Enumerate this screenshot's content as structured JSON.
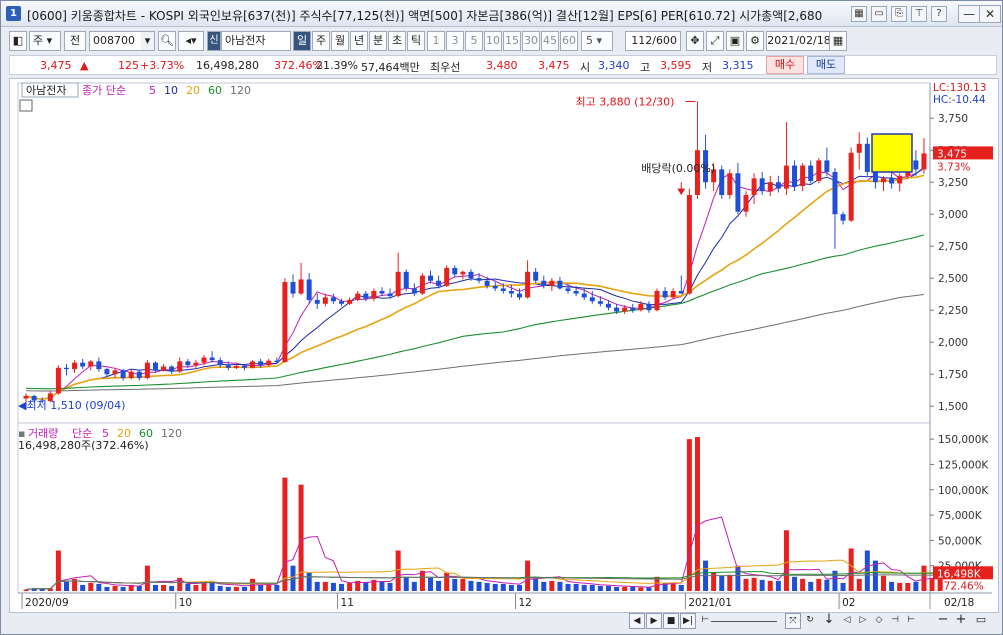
{
  "titlebar": {
    "title": "[0600] 키움종합차트 - KOSPI 외국인보유[637(천)] 주식수[77,125(천)] 액면[500] 자본금[386(억)] 결산[12월] EPS[6] PER[610.72] 시가총액[2,680",
    "app_icon": "1"
  },
  "toolbar": {
    "period_type": "주",
    "prev_label": "전",
    "code": "008700",
    "market_tag": "신",
    "stock_name": "아남전자",
    "periods": [
      "일",
      "주",
      "월",
      "년",
      "분",
      "초",
      "틱"
    ],
    "active_period": "일",
    "intervals": [
      "1",
      "3",
      "5",
      "10",
      "15",
      "30",
      "45",
      "60"
    ],
    "custom_interval": "5",
    "count": "112/600",
    "date": "2021/02/18"
  },
  "quote": {
    "price": "3,475",
    "change": "125",
    "change_pct": "+3.73%",
    "volume": "16,498,280",
    "volume_ratio": "372.46%",
    "turnover": "21.39%",
    "amount": "57,464백만",
    "best_label": "최우선",
    "ask": "3,480",
    "bid": "3,475",
    "open_label": "시",
    "open": "3,340",
    "high_label": "고",
    "high": "3,595",
    "low_label": "저",
    "low": "3,315",
    "buy_label": "매수",
    "sell_label": "매도"
  },
  "chart_data": {
    "type": "candlestick",
    "price_legend": {
      "name": "아남전자",
      "ma_title": "종가 단순",
      "ma_periods": [
        "5",
        "10",
        "20",
        "60",
        "120"
      ],
      "ma_colors": [
        "#c21fb4",
        "#1a2aa8",
        "#e6a410",
        "#1b8f2e",
        "#6e6e6e"
      ]
    },
    "price_axis": {
      "ticks": [
        "3,750",
        "3,500",
        "3,250",
        "3,000",
        "2,750",
        "2,500",
        "2,250",
        "2,000",
        "1,750",
        "1,500"
      ],
      "range": [
        1400,
        3900
      ],
      "lc": "LC:130.13",
      "hc": "HC:-10.44",
      "current": "3,475",
      "current_pct": "3.73%"
    },
    "annotations": {
      "high": "최고 3,880 (12/30)",
      "low": "최저 1,510 (09/04)",
      "dividend": "배당락(0.00%)"
    },
    "volume_legend": {
      "name": "거래량",
      "ma_title": "단순",
      "ma_periods": [
        "5",
        "20",
        "60",
        "120"
      ],
      "ma_colors": [
        "#c21fb4",
        "#e6a410",
        "#1b8f2e",
        "#6e6e6e"
      ],
      "current": "16,498,280주(372.46%)"
    },
    "volume_axis": {
      "ticks": [
        "150,000K",
        "125,000K",
        "100,000K",
        "75,000K",
        "50,000K",
        "25,000K"
      ],
      "range": [
        0,
        160000
      ],
      "current": "16,498K",
      "current_pct": "372.46%"
    },
    "x_axis": {
      "labels": [
        "2020/09",
        "10",
        "11",
        "12",
        "2021/01",
        "02"
      ],
      "last_date": "02/18"
    },
    "candles": [
      {
        "o": 1560,
        "h": 1600,
        "l": 1510,
        "c": 1580
      },
      {
        "o": 1580,
        "h": 1590,
        "l": 1530,
        "c": 1545
      },
      {
        "o": 1545,
        "h": 1570,
        "l": 1525,
        "c": 1540
      },
      {
        "o": 1540,
        "h": 1620,
        "l": 1530,
        "c": 1600
      },
      {
        "o": 1600,
        "h": 1820,
        "l": 1590,
        "c": 1800
      },
      {
        "o": 1800,
        "h": 1830,
        "l": 1740,
        "c": 1790
      },
      {
        "o": 1790,
        "h": 1860,
        "l": 1760,
        "c": 1840
      },
      {
        "o": 1840,
        "h": 1870,
        "l": 1790,
        "c": 1810
      },
      {
        "o": 1810,
        "h": 1860,
        "l": 1780,
        "c": 1850
      },
      {
        "o": 1850,
        "h": 1880,
        "l": 1770,
        "c": 1790
      },
      {
        "o": 1790,
        "h": 1800,
        "l": 1730,
        "c": 1750
      },
      {
        "o": 1750,
        "h": 1800,
        "l": 1720,
        "c": 1780
      },
      {
        "o": 1780,
        "h": 1790,
        "l": 1700,
        "c": 1720
      },
      {
        "o": 1720,
        "h": 1790,
        "l": 1710,
        "c": 1770
      },
      {
        "o": 1770,
        "h": 1780,
        "l": 1700,
        "c": 1720
      },
      {
        "o": 1720,
        "h": 1860,
        "l": 1710,
        "c": 1840
      },
      {
        "o": 1840,
        "h": 1850,
        "l": 1760,
        "c": 1780
      },
      {
        "o": 1780,
        "h": 1830,
        "l": 1770,
        "c": 1810
      },
      {
        "o": 1810,
        "h": 1820,
        "l": 1750,
        "c": 1770
      },
      {
        "o": 1770,
        "h": 1880,
        "l": 1760,
        "c": 1850
      },
      {
        "o": 1850,
        "h": 1870,
        "l": 1800,
        "c": 1820
      },
      {
        "o": 1820,
        "h": 1860,
        "l": 1790,
        "c": 1840
      },
      {
        "o": 1840,
        "h": 1900,
        "l": 1820,
        "c": 1880
      },
      {
        "o": 1880,
        "h": 1930,
        "l": 1840,
        "c": 1860
      },
      {
        "o": 1860,
        "h": 1880,
        "l": 1800,
        "c": 1820
      },
      {
        "o": 1820,
        "h": 1850,
        "l": 1780,
        "c": 1800
      },
      {
        "o": 1800,
        "h": 1830,
        "l": 1790,
        "c": 1815
      },
      {
        "o": 1815,
        "h": 1830,
        "l": 1780,
        "c": 1800
      },
      {
        "o": 1800,
        "h": 1860,
        "l": 1795,
        "c": 1850
      },
      {
        "o": 1850,
        "h": 1870,
        "l": 1800,
        "c": 1820
      },
      {
        "o": 1820,
        "h": 1870,
        "l": 1810,
        "c": 1855
      },
      {
        "o": 1855,
        "h": 1880,
        "l": 1830,
        "c": 1845
      },
      {
        "o": 1845,
        "h": 2500,
        "l": 1840,
        "c": 2470
      },
      {
        "o": 2470,
        "h": 2530,
        "l": 2350,
        "c": 2380
      },
      {
        "o": 2380,
        "h": 2620,
        "l": 2370,
        "c": 2490
      },
      {
        "o": 2490,
        "h": 2540,
        "l": 2300,
        "c": 2330
      },
      {
        "o": 2330,
        "h": 2380,
        "l": 2260,
        "c": 2300
      },
      {
        "o": 2300,
        "h": 2380,
        "l": 2280,
        "c": 2350
      },
      {
        "o": 2350,
        "h": 2380,
        "l": 2300,
        "c": 2320
      },
      {
        "o": 2320,
        "h": 2340,
        "l": 2280,
        "c": 2300
      },
      {
        "o": 2300,
        "h": 2350,
        "l": 2290,
        "c": 2330
      },
      {
        "o": 2330,
        "h": 2400,
        "l": 2320,
        "c": 2380
      },
      {
        "o": 2380,
        "h": 2400,
        "l": 2320,
        "c": 2340
      },
      {
        "o": 2340,
        "h": 2420,
        "l": 2320,
        "c": 2400
      },
      {
        "o": 2400,
        "h": 2430,
        "l": 2360,
        "c": 2380
      },
      {
        "o": 2380,
        "h": 2420,
        "l": 2340,
        "c": 2360
      },
      {
        "o": 2360,
        "h": 2700,
        "l": 2350,
        "c": 2550
      },
      {
        "o": 2550,
        "h": 2570,
        "l": 2400,
        "c": 2420
      },
      {
        "o": 2420,
        "h": 2460,
        "l": 2360,
        "c": 2380
      },
      {
        "o": 2380,
        "h": 2540,
        "l": 2370,
        "c": 2520
      },
      {
        "o": 2520,
        "h": 2560,
        "l": 2460,
        "c": 2480
      },
      {
        "o": 2480,
        "h": 2520,
        "l": 2420,
        "c": 2440
      },
      {
        "o": 2440,
        "h": 2600,
        "l": 2430,
        "c": 2580
      },
      {
        "o": 2580,
        "h": 2600,
        "l": 2510,
        "c": 2530
      },
      {
        "o": 2530,
        "h": 2560,
        "l": 2490,
        "c": 2550
      },
      {
        "o": 2550,
        "h": 2570,
        "l": 2480,
        "c": 2500
      },
      {
        "o": 2500,
        "h": 2540,
        "l": 2460,
        "c": 2480
      },
      {
        "o": 2480,
        "h": 2510,
        "l": 2420,
        "c": 2440
      },
      {
        "o": 2440,
        "h": 2480,
        "l": 2400,
        "c": 2420
      },
      {
        "o": 2420,
        "h": 2460,
        "l": 2380,
        "c": 2400
      },
      {
        "o": 2400,
        "h": 2450,
        "l": 2350,
        "c": 2380
      },
      {
        "o": 2380,
        "h": 2420,
        "l": 2330,
        "c": 2350
      },
      {
        "o": 2350,
        "h": 2640,
        "l": 2340,
        "c": 2550
      },
      {
        "o": 2550,
        "h": 2580,
        "l": 2460,
        "c": 2480
      },
      {
        "o": 2480,
        "h": 2520,
        "l": 2420,
        "c": 2440
      },
      {
        "o": 2440,
        "h": 2500,
        "l": 2400,
        "c": 2480
      },
      {
        "o": 2480,
        "h": 2510,
        "l": 2410,
        "c": 2420
      },
      {
        "o": 2420,
        "h": 2460,
        "l": 2380,
        "c": 2400
      },
      {
        "o": 2400,
        "h": 2440,
        "l": 2360,
        "c": 2380
      },
      {
        "o": 2380,
        "h": 2420,
        "l": 2330,
        "c": 2350
      },
      {
        "o": 2350,
        "h": 2400,
        "l": 2300,
        "c": 2320
      },
      {
        "o": 2320,
        "h": 2360,
        "l": 2280,
        "c": 2300
      },
      {
        "o": 2300,
        "h": 2330,
        "l": 2250,
        "c": 2270
      },
      {
        "o": 2270,
        "h": 2300,
        "l": 2220,
        "c": 2240
      },
      {
        "o": 2240,
        "h": 2290,
        "l": 2220,
        "c": 2270
      },
      {
        "o": 2270,
        "h": 2300,
        "l": 2230,
        "c": 2250
      },
      {
        "o": 2250,
        "h": 2320,
        "l": 2240,
        "c": 2300
      },
      {
        "o": 2300,
        "h": 2320,
        "l": 2230,
        "c": 2250
      },
      {
        "o": 2250,
        "h": 2420,
        "l": 2240,
        "c": 2400
      },
      {
        "o": 2400,
        "h": 2430,
        "l": 2330,
        "c": 2350
      },
      {
        "o": 2350,
        "h": 2420,
        "l": 2340,
        "c": 2400
      },
      {
        "o": 2400,
        "h": 2520,
        "l": 2390,
        "c": 2380
      },
      {
        "o": 2380,
        "h": 3200,
        "l": 2370,
        "c": 3150
      },
      {
        "o": 3150,
        "h": 3880,
        "l": 3120,
        "c": 3500
      },
      {
        "o": 3500,
        "h": 3620,
        "l": 3200,
        "c": 3250
      },
      {
        "o": 3250,
        "h": 3400,
        "l": 3180,
        "c": 3350
      },
      {
        "o": 3350,
        "h": 3380,
        "l": 3120,
        "c": 3150
      },
      {
        "o": 3150,
        "h": 3350,
        "l": 3120,
        "c": 3320
      },
      {
        "o": 3320,
        "h": 3400,
        "l": 3000,
        "c": 3020
      },
      {
        "o": 3020,
        "h": 3180,
        "l": 2980,
        "c": 3150
      },
      {
        "o": 3150,
        "h": 3320,
        "l": 3080,
        "c": 3280
      },
      {
        "o": 3280,
        "h": 3330,
        "l": 3150,
        "c": 3180
      },
      {
        "o": 3180,
        "h": 3300,
        "l": 3140,
        "c": 3250
      },
      {
        "o": 3250,
        "h": 3300,
        "l": 3170,
        "c": 3200
      },
      {
        "o": 3200,
        "h": 3720,
        "l": 3150,
        "c": 3380
      },
      {
        "o": 3380,
        "h": 3420,
        "l": 3180,
        "c": 3220
      },
      {
        "o": 3220,
        "h": 3400,
        "l": 3180,
        "c": 3380
      },
      {
        "o": 3380,
        "h": 3420,
        "l": 3240,
        "c": 3260
      },
      {
        "o": 3260,
        "h": 3440,
        "l": 3240,
        "c": 3420
      },
      {
        "o": 3420,
        "h": 3520,
        "l": 3300,
        "c": 3330
      },
      {
        "o": 3330,
        "h": 3360,
        "l": 2730,
        "c": 3000
      },
      {
        "o": 3000,
        "h": 3020,
        "l": 2920,
        "c": 2950
      },
      {
        "o": 2950,
        "h": 3520,
        "l": 2940,
        "c": 3480
      },
      {
        "o": 3480,
        "h": 3640,
        "l": 3350,
        "c": 3550
      },
      {
        "o": 3550,
        "h": 3600,
        "l": 3300,
        "c": 3330
      },
      {
        "o": 3330,
        "h": 3380,
        "l": 3200,
        "c": 3250
      },
      {
        "o": 3250,
        "h": 3300,
        "l": 3180,
        "c": 3280
      },
      {
        "o": 3280,
        "h": 3380,
        "l": 3200,
        "c": 3240
      },
      {
        "o": 3240,
        "h": 3320,
        "l": 3180,
        "c": 3300
      },
      {
        "o": 3300,
        "h": 3520,
        "l": 3280,
        "c": 3420
      },
      {
        "o": 3420,
        "h": 3500,
        "l": 3300,
        "c": 3350
      },
      {
        "o": 3350,
        "h": 3595,
        "l": 3315,
        "c": 3475
      }
    ],
    "volumes": [
      1500,
      3000,
      2000,
      2500,
      40000,
      9000,
      12000,
      6000,
      8000,
      7000,
      4000,
      5000,
      4000,
      6000,
      5000,
      25000,
      6000,
      6000,
      5000,
      13000,
      7000,
      6000,
      9000,
      8000,
      5000,
      4000,
      4000,
      4000,
      12000,
      6000,
      6000,
      6000,
      112000,
      25000,
      105000,
      18000,
      9000,
      9000,
      8000,
      7000,
      8000,
      10000,
      9000,
      11000,
      9000,
      8000,
      40000,
      14000,
      9000,
      20000,
      13000,
      10000,
      18000,
      12000,
      12000,
      10000,
      9000,
      8000,
      7000,
      7000,
      6000,
      6000,
      30000,
      12000,
      9000,
      10000,
      9000,
      7000,
      7000,
      6000,
      6000,
      5000,
      5000,
      4000,
      4000,
      4000,
      3500,
      3500,
      14000,
      8000,
      8000,
      6000,
      150000,
      152000,
      30000,
      18000,
      15000,
      16000,
      25000,
      12000,
      13000,
      11000,
      10000,
      10000,
      60000,
      14000,
      12000,
      9000,
      12000,
      11000,
      20000,
      8000,
      42000,
      12000,
      40000,
      30000,
      15000,
      9000,
      8000,
      8000,
      9000,
      25000,
      12000,
      16500
    ]
  },
  "bottom": {
    "zoom_out": "−",
    "zoom_in": "+",
    "arrow": "↓"
  }
}
